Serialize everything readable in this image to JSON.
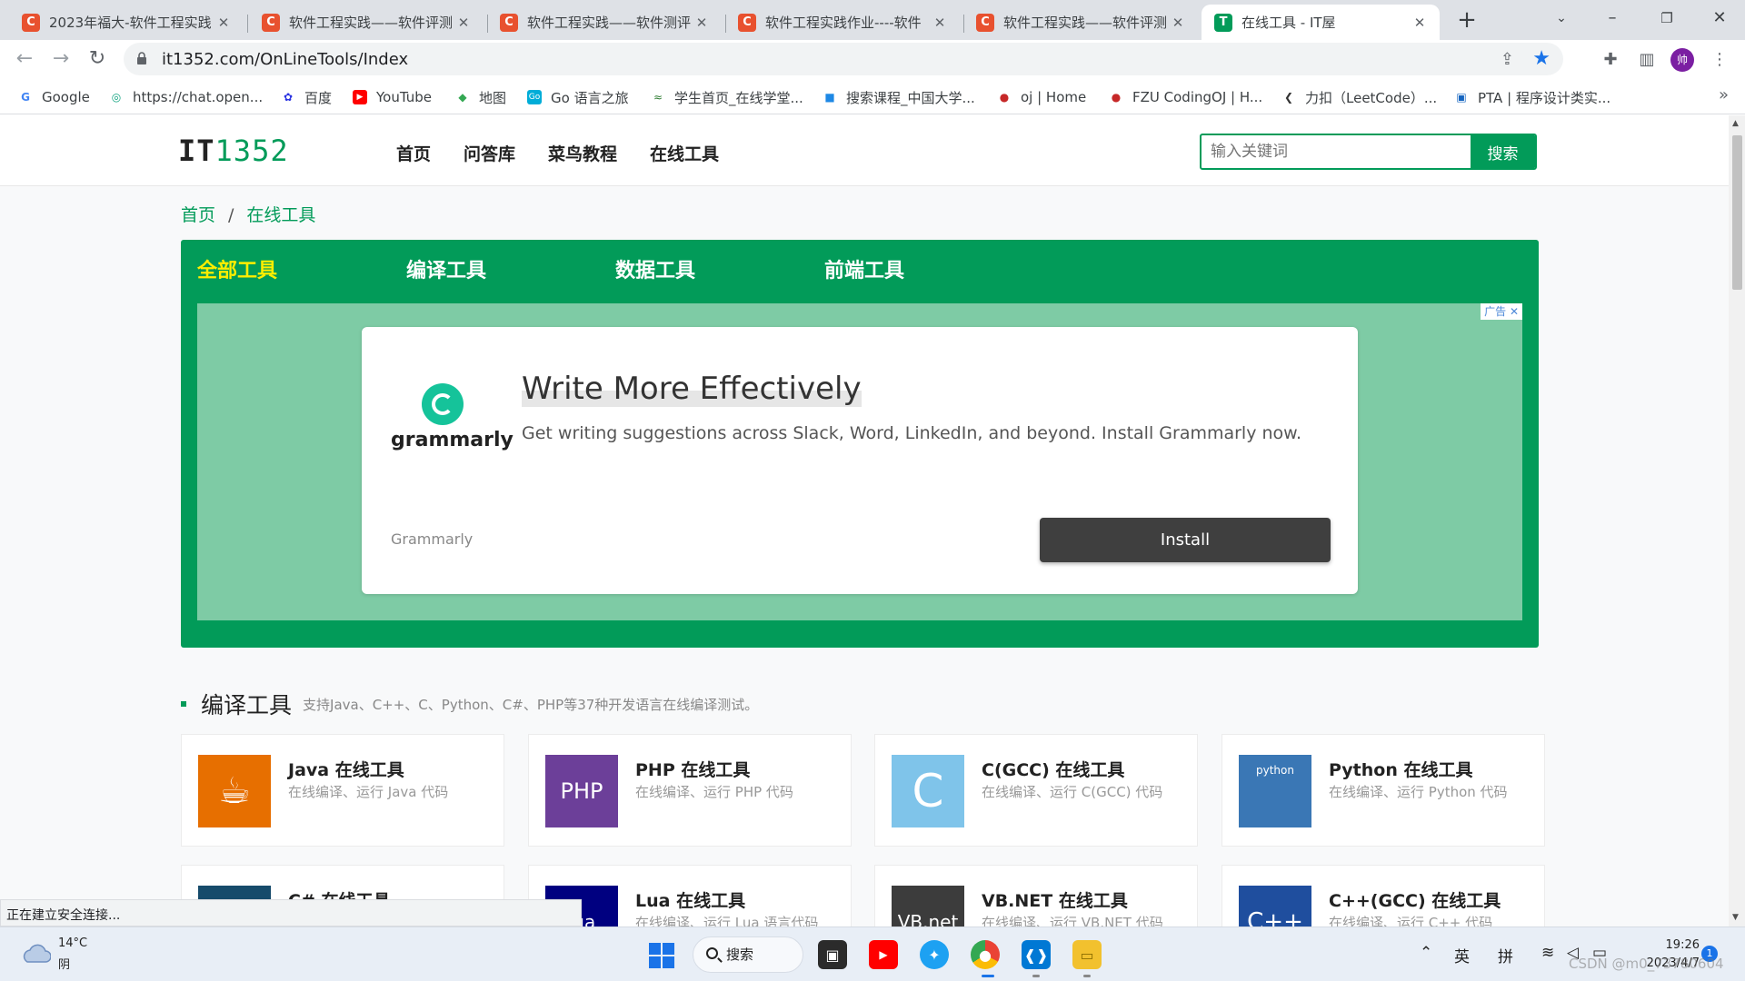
{
  "browser": {
    "tabs": [
      {
        "title": "2023年福大-软件工程实践",
        "favicon": "C"
      },
      {
        "title": "软件工程实践——软件评测",
        "favicon": "C"
      },
      {
        "title": "软件工程实践——软件测评",
        "favicon": "C"
      },
      {
        "title": "软件工程实践作业----软件",
        "favicon": "C"
      },
      {
        "title": "软件工程实践——软件评测",
        "favicon": "C"
      },
      {
        "title": "在线工具 - IT屋",
        "favicon": "T"
      }
    ],
    "url": "it1352.com/OnLineTools/Index",
    "profile_initial": "帅",
    "bookmarks": [
      {
        "label": "Google",
        "icon": "G",
        "color": "#4285f4"
      },
      {
        "label": "https://chat.open...",
        "icon": "◎",
        "color": "#10a37f"
      },
      {
        "label": "百度",
        "icon": "✿",
        "color": "#2932e1"
      },
      {
        "label": "YouTube",
        "icon": "▶",
        "color": "#ff0000"
      },
      {
        "label": "地图",
        "icon": "◆",
        "color": "#34a853"
      },
      {
        "label": "Go 语言之旅",
        "icon": "Go",
        "color": "#00add8"
      },
      {
        "label": "学生首页_在线学堂...",
        "icon": "≈",
        "color": "#2e7d32"
      },
      {
        "label": "搜索课程_中国大学...",
        "icon": "■",
        "color": "#1e88e5"
      },
      {
        "label": "oj | Home",
        "icon": "●",
        "color": "#c62828"
      },
      {
        "label": "FZU CodingOJ | H...",
        "icon": "●",
        "color": "#c62828"
      },
      {
        "label": "力扣（LeetCode）...",
        "icon": "❮",
        "color": "#333333"
      },
      {
        "label": "PTA | 程序设计类实...",
        "icon": "▣",
        "color": "#1565c0"
      }
    ]
  },
  "site": {
    "logo_a": "IT",
    "logo_b": "1352",
    "nav": [
      "首页",
      "问答库",
      "菜鸟教程",
      "在线工具"
    ],
    "search_placeholder": "输入关键词",
    "search_button": "搜索",
    "breadcrumb": [
      "首页",
      "在线工具"
    ],
    "categories": [
      "全部工具",
      "编译工具",
      "数据工具",
      "前端工具"
    ],
    "accent_color": "#029b59"
  },
  "ad": {
    "tag": "广告",
    "logo_word": "grammarly",
    "headline": "Write More Effectively",
    "subtext": "Get writing suggestions across Slack, Word, LinkedIn, and beyond. Install Grammarly now.",
    "brand": "Grammarly",
    "cta": "Install"
  },
  "section": {
    "title": "编译工具",
    "desc": "支持Java、C++、C、Python、C#、PHP等37种开发语言在线编译测试。"
  },
  "tools": [
    {
      "name": "Java 在线工具",
      "desc": "在线编译、运行 Java 代码",
      "icon_text": "☕",
      "bg": "#e76f00"
    },
    {
      "name": "PHP 在线工具",
      "desc": "在线编译、运行 PHP 代码",
      "icon_text": "PHP",
      "bg": "#6c3f99"
    },
    {
      "name": "C(GCC) 在线工具",
      "desc": "在线编译、运行 C(GCC) 代码",
      "icon_text": "C",
      "bg": "#7fc4ea"
    },
    {
      "name": "Python 在线工具",
      "desc": "在线编译、运行 Python 代码",
      "icon_text": "python",
      "bg": "#3a77b5"
    },
    {
      "name": "C# 在线工具",
      "desc": "",
      "icon_text": "",
      "bg": "#164b6b"
    },
    {
      "name": "Lua 在线工具",
      "desc": "在线编译、运行 Lua 语言代码",
      "icon_text": "lua",
      "bg": "#000080"
    },
    {
      "name": "VB.NET 在线工具",
      "desc": "在线编译、运行 VB.NET 代码",
      "icon_text": "VB.net",
      "bg": "#3c3c3c"
    },
    {
      "name": "C++(GCC) 在线工具",
      "desc": "在线编译、运行 C++ 代码",
      "icon_text": "C++",
      "bg": "#1f4e9e"
    }
  ],
  "status_text": "正在建立安全连接...",
  "taskbar": {
    "temp": "14°C",
    "weather": "阴",
    "search": "搜索",
    "ime1": "英",
    "ime2": "拼",
    "time": "19:26",
    "date": "2023/4/7",
    "notif_count": "1"
  },
  "watermark": "CSDN @m0_73780604"
}
